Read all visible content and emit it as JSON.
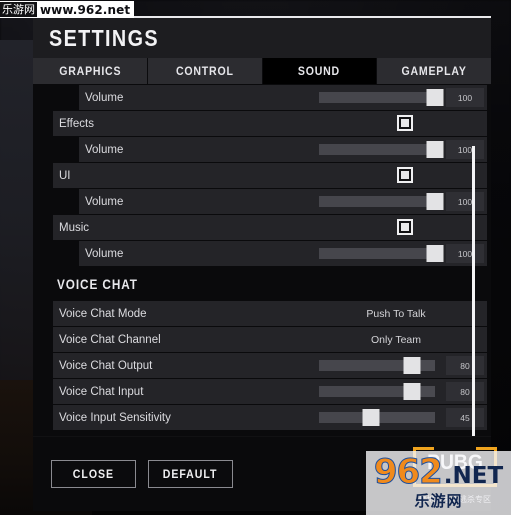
{
  "watermark_top": {
    "cn": "乐游网",
    "url": "www.962.net"
  },
  "dialog": {
    "title": "SETTINGS",
    "tabs": [
      {
        "label": "GRAPHICS",
        "active": false
      },
      {
        "label": "CONTROL",
        "active": false
      },
      {
        "label": "SOUND",
        "active": true
      },
      {
        "label": "GAMEPLAY",
        "active": false
      }
    ],
    "rows": [
      {
        "kind": "child",
        "label": "Volume",
        "control": "slider",
        "value": "100",
        "percent": 100
      },
      {
        "kind": "parent",
        "label": "Effects",
        "control": "checkbox",
        "checked": true
      },
      {
        "kind": "child",
        "label": "Volume",
        "control": "slider",
        "value": "100",
        "percent": 100
      },
      {
        "kind": "parent",
        "label": "UI",
        "control": "checkbox",
        "checked": true
      },
      {
        "kind": "child",
        "label": "Volume",
        "control": "slider",
        "value": "100",
        "percent": 100
      },
      {
        "kind": "parent",
        "label": "Music",
        "control": "checkbox",
        "checked": true
      },
      {
        "kind": "child",
        "label": "Volume",
        "control": "slider",
        "value": "100",
        "percent": 100
      }
    ],
    "section_voice_chat": "VOICE CHAT",
    "voice_rows": [
      {
        "kind": "plain",
        "label": "Voice Chat Mode",
        "control": "text",
        "value": "Push To Talk"
      },
      {
        "kind": "plain",
        "label": "Voice Chat Channel",
        "control": "text",
        "value": "Only Team"
      },
      {
        "kind": "plain",
        "label": "Voice Chat Output",
        "control": "slider",
        "value": "80",
        "percent": 80
      },
      {
        "kind": "plain",
        "label": "Voice Chat Input",
        "control": "slider",
        "value": "80",
        "percent": 80
      },
      {
        "kind": "plain",
        "label": "Voice Input Sensitivity",
        "control": "slider",
        "value": "45",
        "percent": 45
      }
    ],
    "footer": {
      "close_label": "CLOSE",
      "default_label": "DEFAULT"
    }
  },
  "logo": {
    "pubg_text": "PUBG",
    "pubg_sub": "绝地求生大逃杀专区"
  },
  "watermark_bottom": {
    "num": "962",
    "net": ".NET",
    "cn": "乐游网"
  },
  "colors": {
    "accent_orange": "#f0a41e",
    "row_bg": "#242428",
    "dialog_bg": "#111113",
    "tab_active": "#000000"
  }
}
